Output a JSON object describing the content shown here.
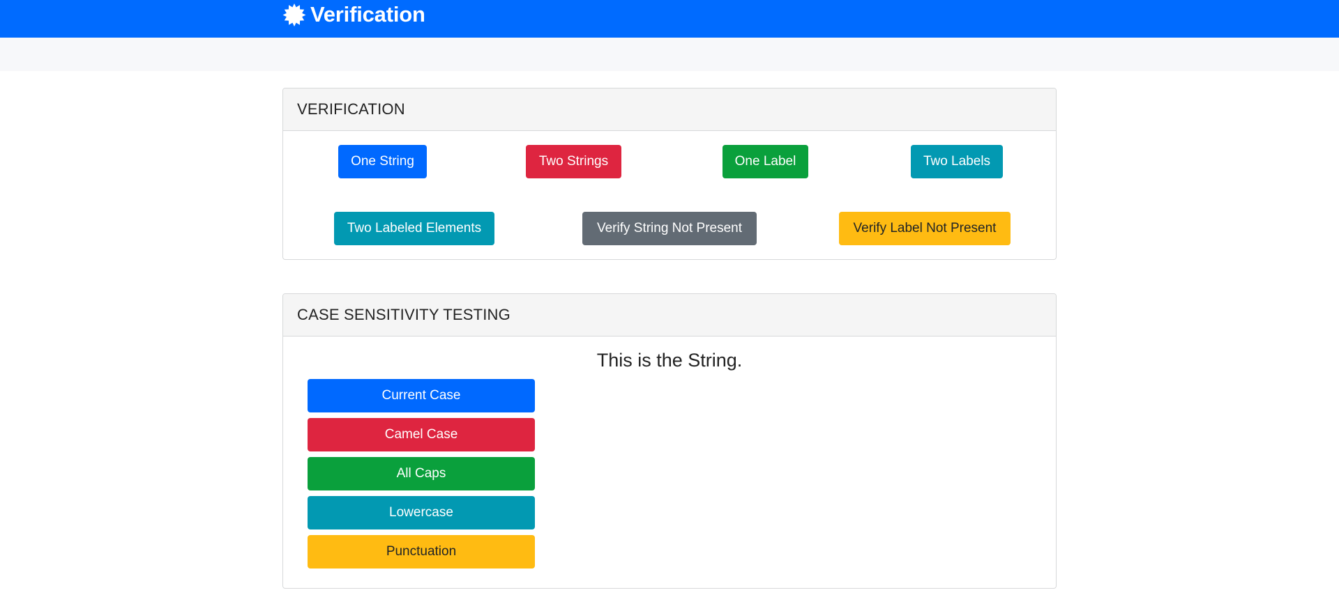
{
  "app": {
    "title": "Verification",
    "brand_icon": "settings-badge-icon"
  },
  "verification": {
    "header": "VERIFICATION",
    "buttons": [
      {
        "label": "One String",
        "color": "#0069ff"
      },
      {
        "label": "Two Strings",
        "color": "#de2540"
      },
      {
        "label": "One Label",
        "color": "#0aa03c"
      },
      {
        "label": "Two Labels",
        "color": "#0299b2"
      },
      {
        "label": "Two Labeled Elements",
        "color": "#0299b2"
      },
      {
        "label": "Verify String Not Present",
        "color": "#626b74"
      },
      {
        "label": "Verify Label Not Present",
        "color": "#ffbb12"
      }
    ]
  },
  "case_testing": {
    "header": "CASE SENSITIVITY TESTING",
    "display_text": "This is the String.",
    "buttons": [
      {
        "label": "Current Case",
        "color": "#0069ff"
      },
      {
        "label": "Camel Case",
        "color": "#de2540"
      },
      {
        "label": "All Caps",
        "color": "#0aa03c"
      },
      {
        "label": "Lowercase",
        "color": "#0299b2"
      },
      {
        "label": "Punctuation",
        "color": "#ffbb12"
      }
    ]
  }
}
